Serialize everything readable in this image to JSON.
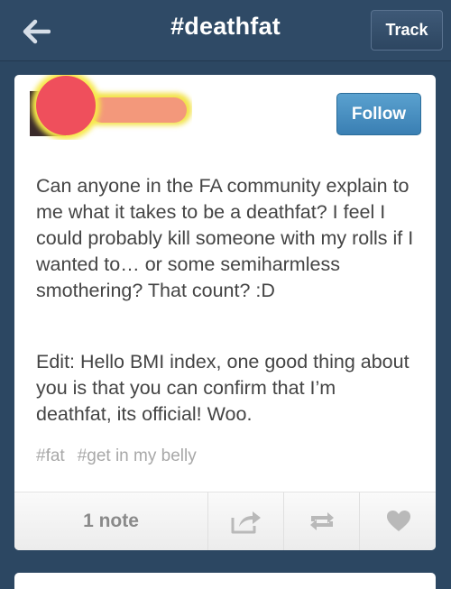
{
  "header": {
    "back_icon": "back-arrow-icon",
    "title": "#deathfat",
    "track_label": "Track"
  },
  "post": {
    "follow_label": "Follow",
    "paragraph1": "Can anyone in the FA community explain to me what it takes to be a deathfat? I feel I could probably kill someone with my rolls if I wanted to… or some semiharmless smothering? That count? :D",
    "paragraph2": "Edit: Hello BMI index, one good thing about you is that you can confirm that I’m deathfat, its official! Woo.",
    "tags": [
      "#fat",
      "#get in my belly"
    ],
    "notes_label": "1 note"
  },
  "colors": {
    "header_bg": "#2f4a66",
    "page_bg": "#2c4762",
    "follow_blue": "#3a7fb3"
  }
}
